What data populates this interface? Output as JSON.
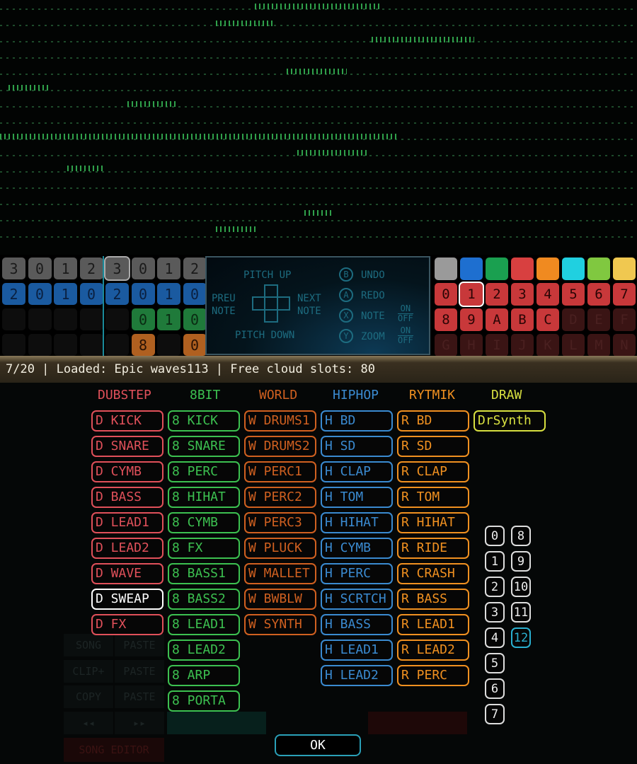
{
  "pattern_grid": {
    "rows": [
      {
        "color": "gray",
        "cells": [
          "3",
          "0",
          "1",
          "2",
          "3",
          "0",
          "1",
          "2"
        ]
      },
      {
        "color": "blue",
        "cells": [
          "2",
          "0",
          "1",
          "0",
          "2",
          "0",
          "1",
          "0"
        ]
      },
      {
        "color": "green",
        "cells": [
          "",
          "",
          "",
          "",
          "",
          "0",
          "1",
          "0"
        ]
      },
      {
        "color": "orange",
        "cells": [
          "",
          "",
          "",
          "",
          "",
          "8",
          "",
          "0"
        ]
      }
    ],
    "selected_cell": [
      0,
      4
    ]
  },
  "controls_panel": {
    "pitch_up": "PITCH UP",
    "pitch_down": "PITCH DOWN",
    "prev_note": [
      "PREU",
      "NOTE"
    ],
    "next_note": [
      "NEXT",
      "NOTE"
    ],
    "b": "B",
    "b_label": "UNDO",
    "a": "A",
    "a_label": "REDO",
    "x": "X",
    "x_label": "NOTE",
    "y": "Y",
    "y_label": "ZOOM",
    "on": "ON",
    "off": "OFF"
  },
  "palette": {
    "colors": [
      "#9a9a9a",
      "#1e6fd0",
      "#1aa050",
      "#d84040",
      "#f08a20",
      "#20d0e0",
      "#80c840",
      "#f0c850"
    ],
    "pattern_slots": [
      "0",
      "1",
      "2",
      "3",
      "4",
      "5",
      "6",
      "7",
      "8",
      "9",
      "A",
      "B",
      "C",
      "D",
      "E",
      "F",
      "G",
      "H",
      "I",
      "J",
      "K",
      "L",
      "M",
      "N"
    ],
    "active_slots": 13,
    "selected_slot": "1"
  },
  "status_bar": {
    "text": "7/20 | Loaded: Epic waves113 | Free cloud slots: 80"
  },
  "background_labels": {
    "song": "SONG",
    "paste": "PASTE",
    "clip_plus": "CLIP+",
    "copy": "COPY",
    "song_editor": "SONG EDITOR",
    "rewind": "◂◂",
    "forward": "▸▸"
  },
  "instrument_categories": [
    {
      "name": "DUBSTEP",
      "color": "#e0505a",
      "items": [
        "D KICK",
        "D SNARE",
        "D CYMB",
        "D BASS",
        "D LEAD1",
        "D LEAD2",
        "D WAVE",
        "D SWEAP",
        "D FX"
      ]
    },
    {
      "name": "8BIT",
      "color": "#3cc050",
      "items": [
        "8 KICK",
        "8 SNARE",
        "8 PERC",
        "8 HIHAT",
        "8 CYMB",
        "8 FX",
        "8 BASS1",
        "8 BASS2",
        "8 LEAD1",
        "8 LEAD2",
        "8 ARP",
        "8 PORTA"
      ]
    },
    {
      "name": "WORLD",
      "color": "#d06020",
      "items": [
        "W DRUMS1",
        "W DRUMS2",
        "W PERC1",
        "W PERC2",
        "W PERC3",
        "W PLUCK",
        "W MALLET",
        "W BWBLW",
        "W SYNTH"
      ]
    },
    {
      "name": "HIPHOP",
      "color": "#3a8ad0",
      "items": [
        "H BD",
        "H SD",
        "H CLAP",
        "H TOM",
        "H HIHAT",
        "H CYMB",
        "H PERC",
        "H SCRTCH",
        "H BASS",
        "H LEAD1",
        "H LEAD2"
      ]
    },
    {
      "name": "RYTMIK",
      "color": "#f09020",
      "items": [
        "R BD",
        "R SD",
        "R CLAP",
        "R TOM",
        "R HIHAT",
        "R RIDE",
        "R CRASH",
        "R BASS",
        "R LEAD1",
        "R LEAD2",
        "R PERC"
      ]
    },
    {
      "name": "DRAW",
      "color": "#d8e040",
      "items": [
        "DrSynth"
      ]
    }
  ],
  "selected_instrument": "D SWEAP",
  "numbers": {
    "col1": [
      "0",
      "1",
      "2",
      "3",
      "4",
      "5",
      "6",
      "7"
    ],
    "col2": [
      "8",
      "9",
      "10",
      "11",
      "12"
    ],
    "selected": "12",
    "selected_color": "#2ab0d0"
  },
  "ok_label": "OK"
}
